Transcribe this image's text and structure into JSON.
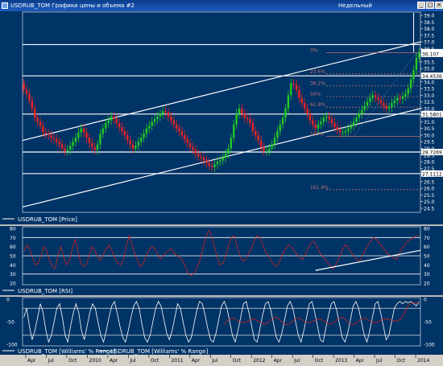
{
  "window": {
    "title": "USDRUB_TOM Графики цены и объема #2",
    "period": "Недельный",
    "buttons": [
      "_",
      "□",
      "×"
    ]
  },
  "chart_data": [
    {
      "type": "candlestick",
      "legend": "USDRUB_TOM [Price]",
      "ylim": [
        24.5,
        39.0
      ],
      "y_ticks": [
        "39.0",
        "38.5",
        "38.0",
        "37.5",
        "37.0",
        "36.5",
        "36.0",
        "35.5",
        "35.0",
        "34.5",
        "34.0",
        "33.5",
        "33.0",
        "32.5",
        "32.0",
        "31.5",
        "31.0",
        "30.5",
        "30.0",
        "29.5",
        "29.0",
        "28.5",
        "28.0",
        "27.5",
        "27.0",
        "26.5",
        "26.0",
        "25.5",
        "25.0",
        "24.5"
      ],
      "x_labels": [
        "Apr",
        "Jul",
        "Oct",
        "2010",
        "Apr",
        "Jul",
        "Oct",
        "2011",
        "Apr",
        "Jul",
        "Oct",
        "2012",
        "Apr",
        "Jul",
        "Oct",
        "2013",
        "Apr",
        "Jul",
        "Oct",
        "2014"
      ],
      "close": [
        33.4,
        33.1,
        32.6,
        32.0,
        31.3,
        31.0,
        30.7,
        30.2,
        30.1,
        30.0,
        29.8,
        29.7,
        29.5,
        29.3,
        29.0,
        28.8,
        28.9,
        29.2,
        29.5,
        29.8,
        30.2,
        30.5,
        30.2,
        29.8,
        29.4,
        29.1,
        28.9,
        29.3,
        30.1,
        30.5,
        30.9,
        31.1,
        31.4,
        31.2,
        30.9,
        30.6,
        30.3,
        30.0,
        29.6,
        29.3,
        29.0,
        29.2,
        29.5,
        29.8,
        30.1,
        30.5,
        30.7,
        31.0,
        31.2,
        31.4,
        31.6,
        31.8,
        31.7,
        31.4,
        31.1,
        30.8,
        30.5,
        30.3,
        30.0,
        29.7,
        29.4,
        29.1,
        28.9,
        28.6,
        28.4,
        28.3,
        28.1,
        27.9,
        27.7,
        27.6,
        27.8,
        28.0,
        28.1,
        28.3,
        28.6,
        29.0,
        29.8,
        30.8,
        31.6,
        32.0,
        31.6,
        31.3,
        31.2,
        30.9,
        30.3,
        30.0,
        29.6,
        29.1,
        28.8,
        28.8,
        29.0,
        29.3,
        29.8,
        30.3,
        30.8,
        31.3,
        32.0,
        33.0,
        33.9,
        33.8,
        33.4,
        32.8,
        32.4,
        32.0,
        31.6,
        31.1,
        30.8,
        30.5,
        30.8,
        31.0,
        31.3,
        31.4,
        31.2,
        30.9,
        30.6,
        30.4,
        30.2,
        30.2,
        30.3,
        30.5,
        30.7,
        31.0,
        31.3,
        31.6,
        31.9,
        32.2,
        32.5,
        32.8,
        33.0,
        32.8,
        32.6,
        32.4,
        32.2,
        32.0,
        32.1,
        32.4,
        32.6,
        32.8,
        32.7,
        32.9,
        33.1,
        33.5,
        34.2,
        34.9,
        35.8,
        36.2
      ],
      "open": [
        33.9,
        33.4,
        33.1,
        32.6,
        32.0,
        31.3,
        31.0,
        30.7,
        30.2,
        30.1,
        30.0,
        29.8,
        29.7,
        29.5,
        29.3,
        29.0,
        28.8,
        28.9,
        29.2,
        29.5,
        29.8,
        30.2,
        30.5,
        30.2,
        29.8,
        29.4,
        29.1,
        28.9,
        29.3,
        30.1,
        30.5,
        30.9,
        31.1,
        31.4,
        31.2,
        30.9,
        30.6,
        30.3,
        30.0,
        29.6,
        29.3,
        29.0,
        29.2,
        29.5,
        29.8,
        30.1,
        30.5,
        30.7,
        31.0,
        31.2,
        31.4,
        31.6,
        31.8,
        31.7,
        31.4,
        31.1,
        30.8,
        30.5,
        30.3,
        30.0,
        29.7,
        29.4,
        29.1,
        28.9,
        28.6,
        28.4,
        28.3,
        28.1,
        27.9,
        27.7,
        27.6,
        27.8,
        28.0,
        28.1,
        28.3,
        28.6,
        29.0,
        29.8,
        30.8,
        31.6,
        32.0,
        31.6,
        31.3,
        31.2,
        30.9,
        30.3,
        30.0,
        29.6,
        29.1,
        28.8,
        28.8,
        29.0,
        29.3,
        29.8,
        30.3,
        30.8,
        31.3,
        32.0,
        33.0,
        33.9,
        33.8,
        33.4,
        32.8,
        32.4,
        32.0,
        31.6,
        31.1,
        30.8,
        30.5,
        30.8,
        31.0,
        31.3,
        31.4,
        31.2,
        30.9,
        30.6,
        30.4,
        30.2,
        30.2,
        30.3,
        30.5,
        30.7,
        31.0,
        31.3,
        31.6,
        31.9,
        32.2,
        32.5,
        32.8,
        33.0,
        32.8,
        32.6,
        32.4,
        32.2,
        32.0,
        32.1,
        32.4,
        32.6,
        32.8,
        32.7,
        32.9,
        33.1,
        33.5,
        34.2,
        34.9,
        35.8
      ],
      "price_labels": [
        "36.2274",
        "36.107",
        "34.4536",
        "31.5801",
        "28.7269",
        "27.1112"
      ],
      "fibonacci": [
        {
          "label": "0%",
          "value": 36.2
        },
        {
          "label": "23.6%",
          "value": 34.6
        },
        {
          "label": "38.2%",
          "value": 33.7
        },
        {
          "label": "50%",
          "value": 32.9
        },
        {
          "label": "61.8%",
          "value": 32.1
        },
        {
          "label": "100%",
          "value": 29.9
        },
        {
          "label": "161.8%",
          "value": 25.9
        }
      ],
      "horizontal_levels": [
        36.8,
        34.45,
        31.58,
        28.73,
        27.11
      ]
    },
    {
      "type": "line",
      "legend": "USDRUB_TOM [RSI]",
      "ylim": [
        20,
        80
      ],
      "y_ticks": [
        "80",
        "70",
        "60",
        "50",
        "40",
        "30",
        "20"
      ],
      "levels": [
        70,
        50,
        30
      ],
      "values": [
        55,
        62,
        58,
        48,
        40,
        42,
        50,
        60,
        55,
        45,
        38,
        36,
        52,
        60,
        48,
        40,
        45,
        58,
        68,
        55,
        42,
        38,
        40,
        52,
        60,
        55,
        48,
        45,
        52,
        58,
        62,
        55,
        48,
        42,
        40,
        46,
        60,
        72,
        62,
        52,
        44,
        38,
        42,
        50,
        56,
        60,
        58,
        52,
        46,
        50,
        54,
        56,
        58,
        52,
        50,
        48,
        44,
        36,
        30,
        28,
        32,
        38,
        46,
        58,
        70,
        78,
        72,
        60,
        48,
        40,
        42,
        50,
        62,
        70,
        72,
        60,
        50,
        44,
        46,
        52,
        58,
        66,
        72,
        70,
        62,
        54,
        50,
        44,
        40,
        38,
        44,
        52,
        58,
        62,
        60,
        56,
        52,
        48,
        46,
        52,
        58,
        64,
        66,
        60,
        54,
        50,
        46,
        42,
        38,
        36,
        42,
        48,
        56,
        62,
        60,
        54,
        50,
        46,
        44,
        50,
        56,
        62,
        66,
        70,
        68,
        64,
        60,
        56,
        52,
        50,
        48,
        46,
        52,
        58,
        62,
        66,
        68,
        70,
        72,
        72
      ]
    },
    {
      "type": "line",
      "legend": "USDRUB_TOM [Williams' % Range]",
      "legend2": "USDRUB_TOM [Williams' % Range]",
      "ylim": [
        -100,
        0
      ],
      "y_ticks": [
        "0",
        "-50",
        "-100"
      ],
      "levels": [
        -20,
        -80
      ],
      "values": [
        -40,
        -20,
        -60,
        -90,
        -70,
        -40,
        -10,
        -30,
        -70,
        -95,
        -80,
        -50,
        -20,
        -10,
        -40,
        -80,
        -95,
        -60,
        -30,
        -10,
        -30,
        -70,
        -90,
        -60,
        -30,
        -10,
        -20,
        -50,
        -80,
        -95,
        -70,
        -40,
        -15,
        -5,
        -30,
        -60,
        -85,
        -95,
        -70,
        -40,
        -15,
        -5,
        -20,
        -55,
        -85,
        -95,
        -80,
        -50,
        -20,
        -5,
        -15,
        -45,
        -75,
        -90,
        -70,
        -40,
        -10,
        -20,
        -50,
        -80,
        -95,
        -85,
        -55,
        -25,
        -5,
        -10,
        -35,
        -65,
        -90,
        -95,
        -75,
        -45,
        -15,
        -5,
        -20,
        -50,
        -80,
        -95,
        -70,
        -40,
        -10,
        -5,
        -30,
        -60,
        -90,
        -95,
        -65,
        -35,
        -10,
        -5,
        -25,
        -55,
        -85,
        -95,
        -75,
        -45,
        -15,
        -5,
        -20,
        -50,
        -80,
        -95,
        -70,
        -40,
        -10,
        -5,
        -30,
        -60,
        -90,
        -95,
        -65,
        -35,
        -10,
        -5,
        -25,
        -55,
        -85,
        -95,
        -75,
        -45,
        -15,
        -5,
        -20,
        -50,
        -80,
        -95,
        -70,
        -40,
        -10,
        -5,
        -30,
        -60,
        -90,
        -80,
        -50,
        -20,
        -10,
        -5,
        -10,
        -5,
        -8,
        -5,
        -10,
        -15,
        -5
      ]
    }
  ],
  "colors": {
    "background": "#003366",
    "grid": "#ffffff",
    "up": "#22cc22",
    "down": "#ee2222",
    "rsi": "#cc2222",
    "williams": "#ffffff",
    "fib": "#c07070"
  }
}
